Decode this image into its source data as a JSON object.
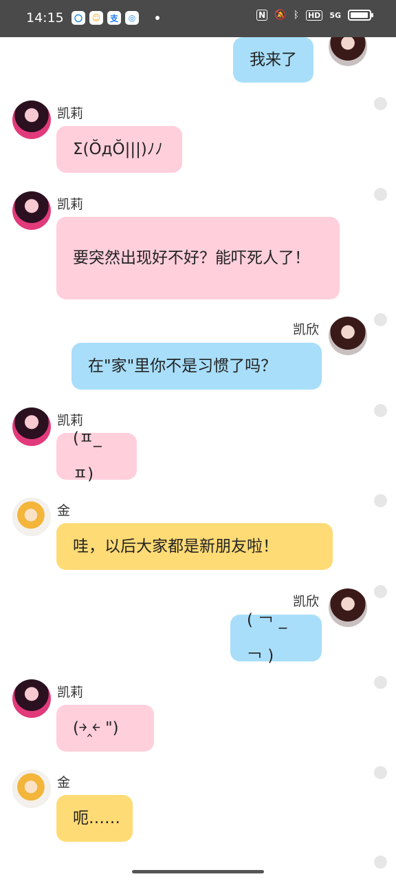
{
  "status_bar": {
    "time": "14:15",
    "apps": [
      "〇",
      "☺",
      "支",
      "◎"
    ],
    "network": "5G",
    "hd": "HD",
    "nfc": "N"
  },
  "messages": [
    {
      "sender": "",
      "side": "right",
      "avatar": "kaixin",
      "text": "我来了",
      "color": "blue"
    },
    {
      "sender": "凯莉",
      "side": "left",
      "avatar": "kaili",
      "text": "Σ(ŎдŎ|||)ﾉﾉ",
      "color": "pink"
    },
    {
      "sender": "凯莉",
      "side": "left",
      "avatar": "kaili",
      "text": "要突然出现好不好？能吓死人了！",
      "color": "pink"
    },
    {
      "sender": "凯欣",
      "side": "right",
      "avatar": "kaixin",
      "text": "在\"家\"里你不是习惯了吗？",
      "color": "blue"
    },
    {
      "sender": "凯莉",
      "side": "left",
      "avatar": "kaili",
      "text": "(ㅍ_ㅍ)",
      "color": "pink"
    },
    {
      "sender": "金",
      "side": "left",
      "avatar": "jin",
      "text": "哇，以后大家都是新朋友啦！",
      "color": "yellow"
    },
    {
      "sender": "凯欣",
      "side": "right",
      "avatar": "kaixin",
      "text": "( ￢ _ ￢ )",
      "color": "blue"
    },
    {
      "sender": "凯莉",
      "side": "left",
      "avatar": "kaili",
      "text": "(￫‸￩ \")",
      "color": "pink"
    },
    {
      "sender": "金",
      "side": "left",
      "avatar": "jin",
      "text": "呃……",
      "color": "yellow"
    }
  ]
}
